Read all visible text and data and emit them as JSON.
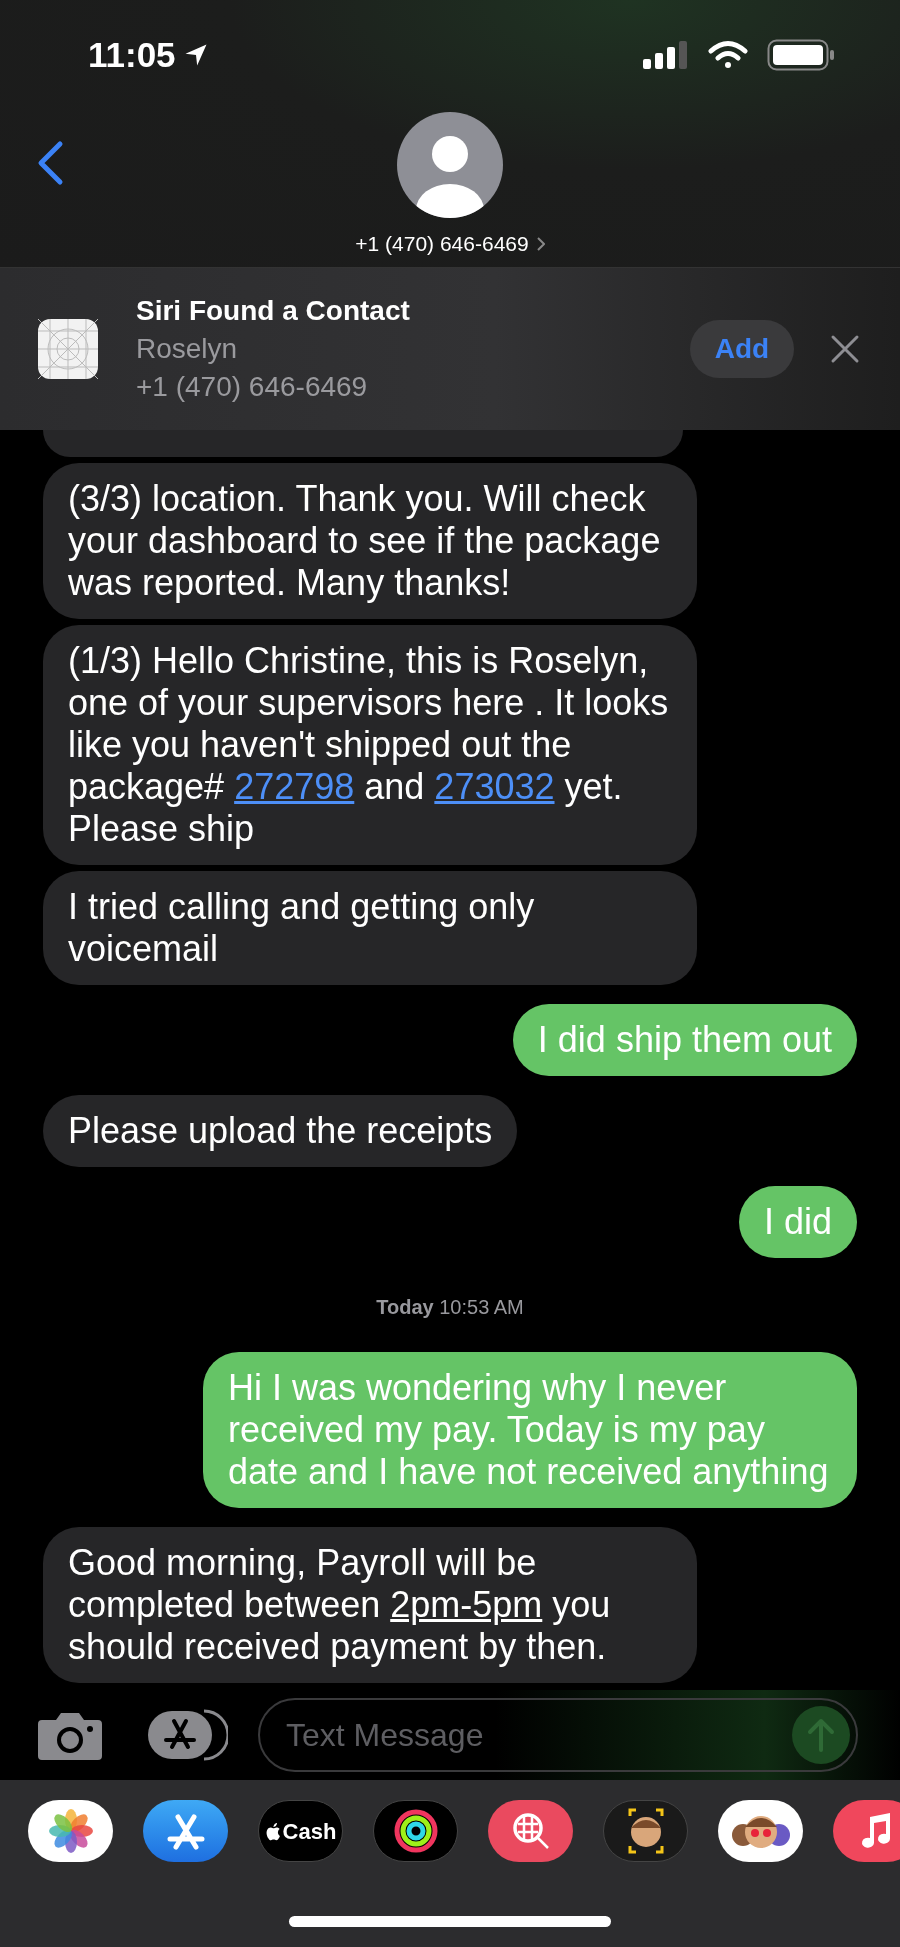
{
  "status_bar": {
    "time": "11:05"
  },
  "header": {
    "contact": "+1 (470) 646-6469"
  },
  "siri_banner": {
    "title": "Siri Found a Contact",
    "name": "Roselyn",
    "phone": "+1 (470) 646-6469",
    "add_button": "Add"
  },
  "messages": [
    {
      "kind": "received",
      "parts": [
        {
          "kind": "plain",
          "text": "(3/3) location. Thank you. Will check your dashboard to see if the package was reported. Many thanks!"
        }
      ]
    },
    {
      "kind": "received",
      "parts": [
        {
          "kind": "plain",
          "text": "(1/3) Hello Christine, this is Roselyn, one of your supervisors here . It looks like you haven't shipped out the package# "
        },
        {
          "kind": "link",
          "text": "272798"
        },
        {
          "kind": "plain",
          "text": " and "
        },
        {
          "kind": "link",
          "text": "273032"
        },
        {
          "kind": "plain",
          "text": " yet. Please ship"
        }
      ]
    },
    {
      "kind": "received",
      "parts": [
        {
          "kind": "plain",
          "text": "I tried calling and getting only voicemail"
        }
      ]
    },
    {
      "kind": "sent",
      "parts": [
        {
          "kind": "plain",
          "text": "I did ship them out"
        }
      ]
    },
    {
      "kind": "received",
      "parts": [
        {
          "kind": "plain",
          "text": "Please upload the receipts"
        }
      ]
    },
    {
      "kind": "sent",
      "parts": [
        {
          "kind": "plain",
          "text": "I did"
        }
      ]
    },
    {
      "kind": "timestamp",
      "text": "**Today** 10:53 AM"
    },
    {
      "kind": "sent",
      "parts": [
        {
          "kind": "plain",
          "text": "Hi I was wondering why I never received my pay. Today is my pay date and I have not received anything"
        }
      ]
    },
    {
      "kind": "received",
      "parts": [
        {
          "kind": "plain",
          "text": "Good morning, Payroll will be completed between "
        },
        {
          "kind": "date",
          "text": "2pm-5pm"
        },
        {
          "kind": "plain",
          "text": " you should received payment by then."
        }
      ]
    }
  ],
  "composer": {
    "placeholder": "Text Message"
  },
  "app_drawer": [
    {
      "kind": "photos"
    },
    {
      "kind": "appstore"
    },
    {
      "kind": "cash",
      "label": "Cash"
    },
    {
      "kind": "activity"
    },
    {
      "kind": "images"
    },
    {
      "kind": "memoji"
    },
    {
      "kind": "stickers"
    },
    {
      "kind": "music"
    }
  ]
}
